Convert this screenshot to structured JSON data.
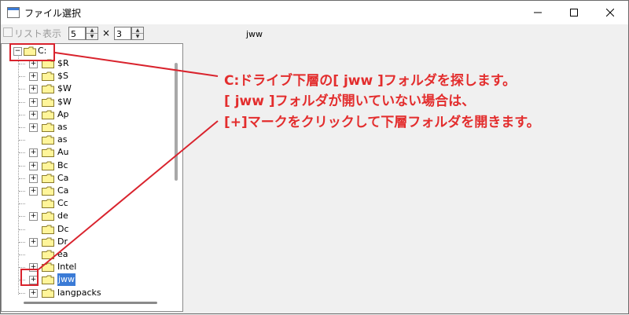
{
  "window": {
    "title": "ファイル選択"
  },
  "toolbar": {
    "list_label": "リスト表示",
    "cols_value": "5",
    "times": "×",
    "rows_value": "3",
    "current_folder": "jww"
  },
  "tree": {
    "root": "C:",
    "items": [
      "$R",
      "$S",
      "$W",
      "$W",
      "Ap",
      "as",
      "as",
      "Au",
      "Bc",
      "Ca",
      "Ca",
      "Cc",
      "de",
      "Dc",
      "Dr",
      "ea",
      "Intel",
      "jww",
      "langpacks"
    ]
  },
  "annotation": {
    "line1": "C:ドライブ下層の[ jww ]フォルダを探します。",
    "line2": "[ jww ]フォルダが開いていない場合は、",
    "line3": "[+]マークをクリックして下層フォルダを開きます。"
  },
  "colors": {
    "annotation": "#e32d2d",
    "selection": "#3b7bd6",
    "folder": "#fff59a"
  }
}
